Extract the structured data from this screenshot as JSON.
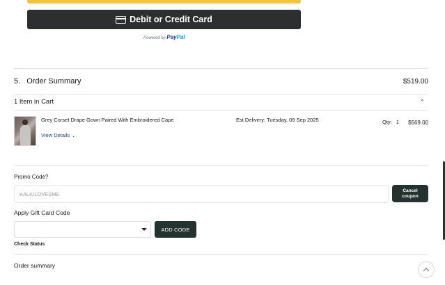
{
  "payment": {
    "card_button_label": "Debit or Credit Card",
    "powered_by": "Powered by",
    "paypal_pay": "Pay",
    "paypal_pal": "Pal"
  },
  "summary": {
    "step_number": "5.",
    "title": "Order Summary",
    "total": "$519.00",
    "items_count": "1 Item in Cart",
    "collapse_icon": "chevron-up-icon"
  },
  "cart_item": {
    "name": "Grey Corset Drape Gown Paired With Embroidered Cape",
    "view_details": "View Details",
    "est_delivery": "Est Delivery: Tuesday, 09 Sep 2025",
    "qty_label": "Qty:",
    "qty_value": "1",
    "price": "$569.00"
  },
  "promo": {
    "label": "Promo Code?",
    "value": "KALKILOVESME",
    "cancel_label": "Cancel coupon"
  },
  "gift_card": {
    "label": "Apply Gift Card Code",
    "selected": "",
    "add_label": "ADD CODE",
    "check_status": "Check Status"
  },
  "footer": {
    "order_summary": "Order summary",
    "scroll_top_icon": "arrow-up-icon"
  },
  "colors": {
    "paypal_yellow": "#f2c53d",
    "card_button_bg": "#2c2e2f",
    "dark_button_bg": "#243230",
    "link_blue": "#1f4a8a"
  }
}
